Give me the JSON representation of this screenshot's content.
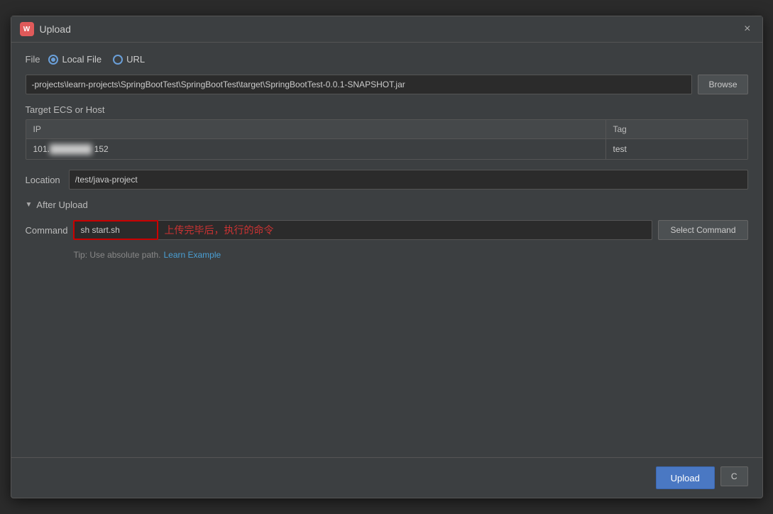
{
  "dialog": {
    "title": "Upload",
    "app_icon_label": "W",
    "close_button": "×"
  },
  "file_section": {
    "label": "File",
    "radio_options": [
      "Local File",
      "URL"
    ],
    "selected_radio": "Local File",
    "file_path": "-projects\\learn-projects\\SpringBootTest\\SpringBootTest\\target\\SpringBootTest-0.0.1-SNAPSHOT.jar",
    "browse_label": "Browse"
  },
  "target_section": {
    "label": "Target ECS or Host",
    "table": {
      "headers": [
        "IP",
        "Tag"
      ],
      "row": {
        "ip": "101.",
        "ip_blurred": "         ",
        "ip_suffix": "152",
        "tag": "test"
      }
    }
  },
  "location_section": {
    "label": "Location",
    "value": "/test/java-project"
  },
  "after_upload_section": {
    "title": "After Upload",
    "command_label": "Command",
    "command_value": "sh start.sh",
    "command_placeholder": "上传完毕后，执行的命令",
    "select_command_label": "Select Command",
    "tip_text": "Tip: Use absolute path.",
    "learn_example_label": "Learn Example"
  },
  "footer": {
    "upload_label": "Upload",
    "cancel_label": "C"
  }
}
